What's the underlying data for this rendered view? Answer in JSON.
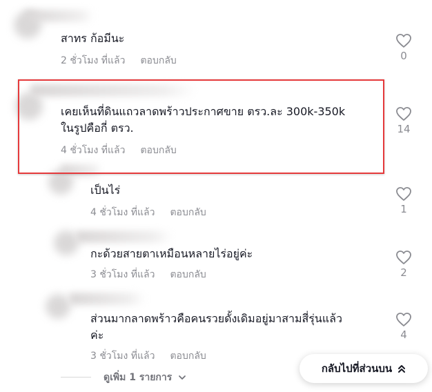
{
  "comments": [
    {
      "text": "สาทร ก้อมีนะ",
      "time": "2 ชั่วโมง ที่แล้ว",
      "reply": "ตอบกลับ",
      "likes": "0"
    },
    {
      "text": "เคยเห็นที่ดินแถวลาดพร้าวประกาศขาย ตรว.ละ 300k-350k\nในรูปคือกี่ ตรว.",
      "time": "4 ชั่วโมง ที่แล้ว",
      "reply": "ตอบกลับ",
      "likes": "14"
    },
    {
      "text": "เป็นไร่",
      "time": "4 ชั่วโมง ที่แล้ว",
      "reply": "ตอบกลับ",
      "likes": "1"
    },
    {
      "text": "กะด้วยสายตาเหมือนหลายไร่อยู่ค่ะ",
      "time": "3 ชั่วโมง ที่แล้ว",
      "reply": "ตอบกลับ",
      "likes": "2"
    },
    {
      "text": "ส่วนมากลาดพร้าวคือคนรวยดั้งเดิมอยู่มาสามสี่รุ่นแล้ว\nค่ะ",
      "time": "3 ชั่วโมง ที่แล้ว",
      "reply": "ตอบกลับ",
      "likes": "4"
    }
  ],
  "see_more": "ดูเพิ่ม 1 รายการ",
  "back_to_top": "กลับไปที่ส่วนบน",
  "colors": {
    "highlight": "#e5393b",
    "muted": "#8a8b91",
    "text": "#161823"
  }
}
